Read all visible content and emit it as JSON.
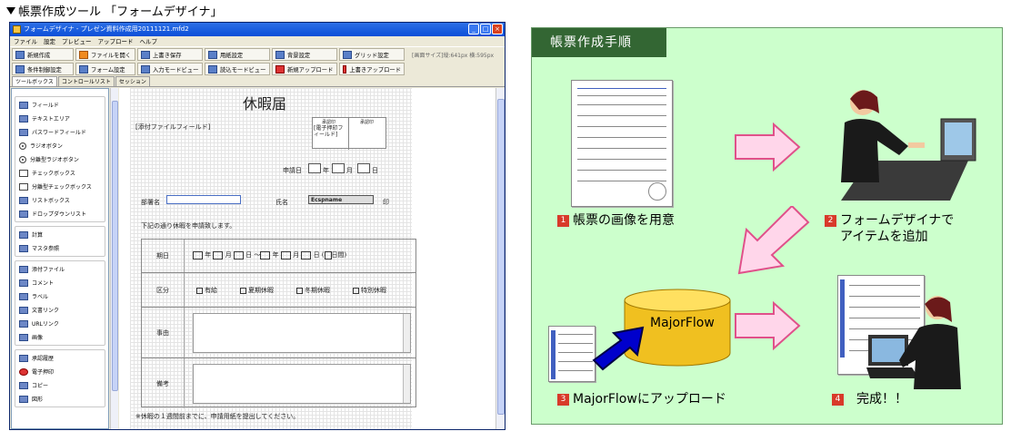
{
  "heading": "帳票作成ツール 「フォームデザイナ」",
  "window": {
    "title": "フォームデザイナ - プレゼン資料作成用20111121.mfd2",
    "menus": [
      "ファイル",
      "設定",
      "プレビュー",
      "アップロード",
      "ヘルプ"
    ],
    "toolbar_row1": [
      "新規作成",
      "ファイルを開く",
      "上書き保存",
      "用紙設定",
      "背景設定",
      "グリッド設定"
    ],
    "toolbar_row2": [
      "条件制御設定",
      "フォーム設定",
      "入力モードビュー",
      "読込モードビュー",
      "新規アップロード",
      "上書きアップロード"
    ],
    "size_info": "[画面サイズ]縦:641px 横:595px",
    "tabs": [
      "ツールボックス",
      "コントロールリスト",
      "セッション"
    ]
  },
  "palette": {
    "group1": [
      "フィールド",
      "テキストエリア",
      "パスワードフィールド",
      "ラジオボタン",
      "分離型ラジオボタン",
      "チェックボックス",
      "分離型チェックボックス",
      "リストボックス",
      "ドロップダウンリスト"
    ],
    "group2": [
      "計算",
      "マスタ参照"
    ],
    "group3": [
      "添付ファイル",
      "コメント",
      "ラベル",
      "文書リンク",
      "URLリンク",
      "画像"
    ],
    "group4": [
      "承認履歴",
      "電子押印",
      "コピー",
      "図形"
    ]
  },
  "form": {
    "title": "休暇届",
    "attach_field": "[添付ファイルフィールド]",
    "stamp_header1": "承認印",
    "stamp_header2": "承認印",
    "stamp_field": "[電子押印フィールド]",
    "apply_date": "申請日",
    "year": "年",
    "month": "月",
    "day": "日",
    "dept": "部署名",
    "name": "氏名",
    "name_value": "Ecspname",
    "seal": "印",
    "notice": "下記の通り休暇を申請致します。",
    "row_period": "期日",
    "tilde": "～",
    "days": "日間",
    "row_kind": "区分",
    "kinds": [
      "有給",
      "夏期休暇",
      "冬期休暇",
      "特別休暇"
    ],
    "row_reason": "事由",
    "row_note": "備考",
    "footnote": "※休暇の１週間前までに、申請用紙を提出してください。"
  },
  "flow": {
    "title": "帳票作成手順",
    "step1_num": "1",
    "step1": "帳票の画像を用意",
    "step2_num": "2",
    "step2_line1": "フォームデザイナで",
    "step2_line2": "アイテムを追加",
    "step3_num": "3",
    "step3": "MajorFlowにアップロード",
    "step4_num": "4",
    "step4": "完成！！",
    "cylinder": "MajorFlow"
  }
}
